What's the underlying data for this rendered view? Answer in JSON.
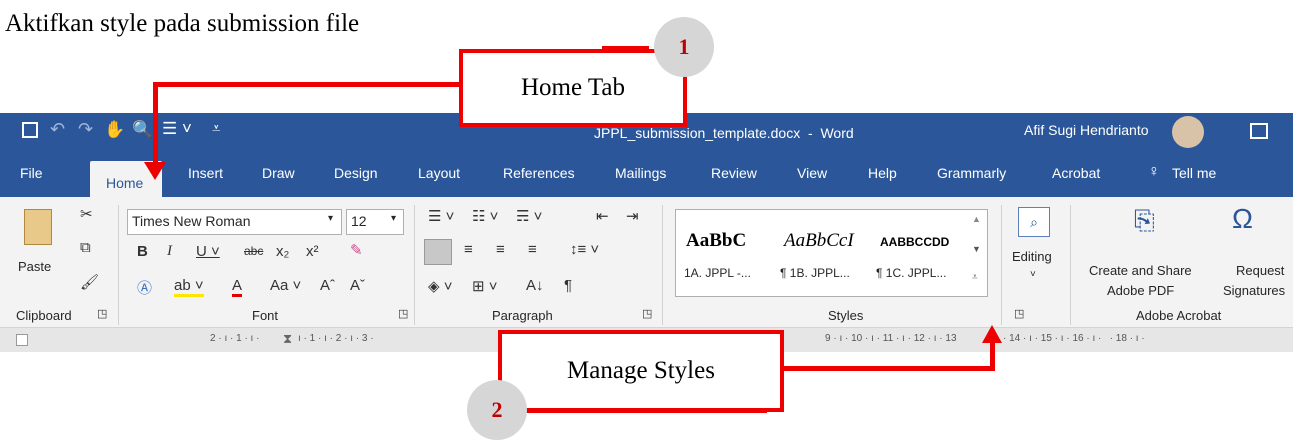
{
  "instruction": "Aktifkan style pada submission file",
  "callouts": {
    "home_tab": {
      "label": "Home Tab",
      "number": "1"
    },
    "manage_styles": {
      "label": "Manage Styles",
      "number": "2"
    }
  },
  "titlebar": {
    "document": "JPPL_submission_template.docx  -  Word",
    "user": "Afif Sugi Hendrianto"
  },
  "tabs": [
    "File",
    "Home",
    "Insert",
    "Draw",
    "Design",
    "Layout",
    "References",
    "Mailings",
    "Review",
    "View",
    "Help",
    "Grammarly",
    "Acrobat"
  ],
  "tell_me": "Tell me",
  "font": {
    "name": "Times New Roman",
    "size": "12"
  },
  "clipboard": {
    "paste": "Paste"
  },
  "styles": {
    "previews": [
      "AaBbC",
      "AaBbCcI",
      "AABBCCDD"
    ],
    "names": [
      "1A. JPPL -...",
      "¶ 1B. JPPL...",
      "¶ 1C. JPPL..."
    ]
  },
  "editing": {
    "label": "Editing"
  },
  "acrobat": {
    "create_line1": "Create and Share",
    "create_line2": "Adobe PDF",
    "request_line1": "Request",
    "request_line2": "Signatures"
  },
  "groups": {
    "clipboard": "Clipboard",
    "font": "Font",
    "paragraph": "Paragraph",
    "styles": "Styles",
    "acrobat": "Adobe Acrobat"
  },
  "ruler_left": "2 · ı · 1 · ı ·",
  "ruler_mid": "ı · 1 · ı · 2 · ı · 3 ·",
  "ruler_right": "9 · ı · 10 · ı · 11 · ı · 12 · ı · 13",
  "ruler_far": "· 14 · ı · 15 · ı · 16 · ı ·   · 18 · ı ·",
  "colors": {
    "word_blue": "#2b579a",
    "callout_red": "#ee0000",
    "ribbon_bg": "#f3f3f3"
  },
  "icons": [
    "save-icon",
    "undo-icon",
    "redo-icon",
    "tell-me-bulb-icon",
    "account-avatar",
    "ribbon-display-icon",
    "paste-icon",
    "cut-icon",
    "copy-icon",
    "format-painter-icon",
    "search-icon",
    "pdf-icon",
    "signature-icon"
  ]
}
